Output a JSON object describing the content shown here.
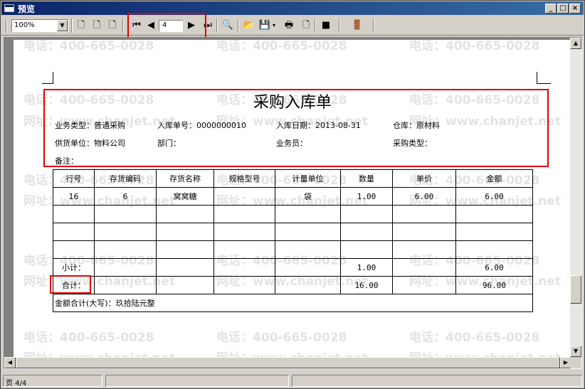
{
  "window": {
    "title": "预览"
  },
  "toolbar": {
    "zoom": "100%",
    "page_input": "4"
  },
  "watermark": {
    "phone": "电话：400-665-0028",
    "site": "网址：www.chanjet.net"
  },
  "document": {
    "title": "采购入库单",
    "header": {
      "biz_type": "业务类型：普通采购",
      "doc_no": "入库单号：0000000010",
      "in_date": "入库日期：2013-08-31",
      "warehouse": "仓库：原材料",
      "supplier": "供货单位：物料公司",
      "dept": "部门：",
      "clerk": "业务员：",
      "purchase_type": "采购类型：",
      "remark": "备注："
    },
    "columns": [
      "行号",
      "存货编码",
      "存货名称",
      "规格型号",
      "计量单位",
      "数量",
      "单价",
      "金额"
    ],
    "rows": [
      {
        "line": "16",
        "code": "6",
        "name": "窝窝糖",
        "spec": "",
        "unit": "袋",
        "qty": "1.00",
        "price": "6.00",
        "amount": "6.00"
      }
    ],
    "subtotal": {
      "label": "小计：",
      "qty": "1.00",
      "amount": "6.00"
    },
    "total": {
      "label": "合计：",
      "qty": "16.00",
      "amount": "96.00"
    },
    "amount_words": "金额合计(大写)：玖拾陆元整"
  },
  "status": {
    "page": "页 4/4"
  }
}
